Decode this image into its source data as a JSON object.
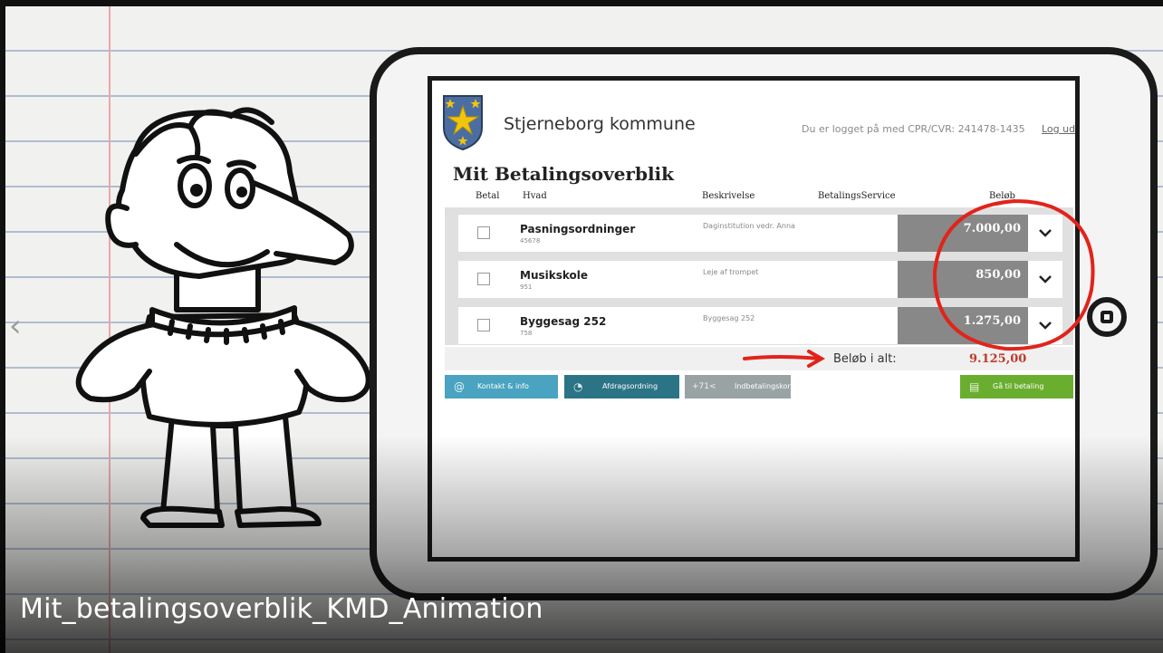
{
  "caption": "Mit_betalingsoverblik_KMD_Animation",
  "navigation": {
    "prev_arrow": "‹"
  },
  "app": {
    "municipality": "Stjerneborg kommune",
    "logged_in_text": "Du er logget på med CPR/CVR: 241478-1435",
    "logout_label": "Log ud",
    "page_title": "Mit Betalingsoverblik"
  },
  "columns": {
    "pay": "Betal",
    "what": "Hvad",
    "description": "Beskrivelse",
    "betalingsservice": "BetalingsService",
    "amount": "Beløb"
  },
  "rows": [
    {
      "name": "Pasningsordninger",
      "number": "45678",
      "description": "Daginstitution vedr. Anna",
      "amount": "7.000,00"
    },
    {
      "name": "Musikskole",
      "number": "951",
      "description": "Leje af trompet",
      "amount": "850,00"
    },
    {
      "name": "Byggesag 252",
      "number": "758",
      "description": "Byggesag 252",
      "amount": "1.275,00"
    }
  ],
  "total": {
    "label": "Beløb i alt:",
    "value": "9.125,00"
  },
  "buttons": {
    "contact": "Kontakt & info",
    "afdrag": "Afdragsordning",
    "indbet_prefix": "+71<",
    "indbet": "Indbetalingskort",
    "pay": "Gå til betaling"
  },
  "icons": {
    "contact": "at-icon",
    "afdrag": "pie-chart-icon",
    "pay": "card-icon",
    "expand": "chevron-down-icon",
    "home": "home-button-icon"
  },
  "colors": {
    "contact": "#4aa3c0",
    "afdrag": "#2b7486",
    "indbet": "#9aa3a3",
    "pay": "#69ae2f",
    "annotation": "#e0241b",
    "amount_bg": "#888888"
  }
}
